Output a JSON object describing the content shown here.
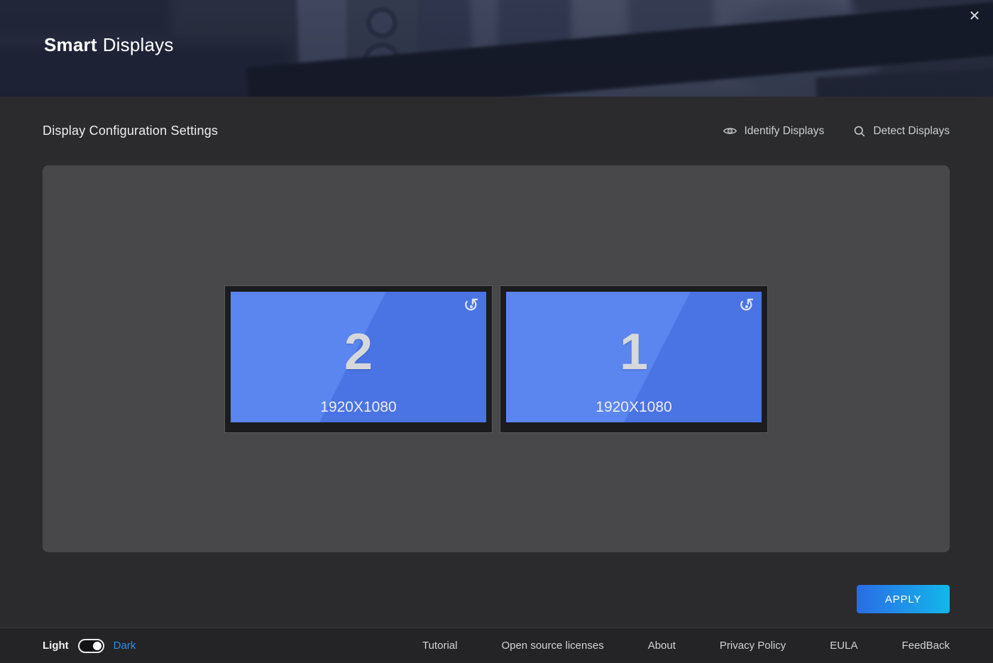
{
  "app": {
    "title_bold": "Smart",
    "title_regular": "Displays",
    "close_icon": "✕"
  },
  "main": {
    "heading": "Display Configuration Settings",
    "actions": {
      "identify_label": "Identify Displays",
      "detect_label": "Detect Displays"
    },
    "apply_label": "APPLY"
  },
  "displays": [
    {
      "number": "2",
      "resolution": "1920X1080",
      "rotate_icon": "↺"
    },
    {
      "number": "1",
      "resolution": "1920X1080",
      "rotate_icon": "↺"
    }
  ],
  "footer": {
    "theme": {
      "light_label": "Light",
      "dark_label": "Dark",
      "selected": "Dark"
    },
    "links": [
      "Tutorial",
      "Open source licenses",
      "About",
      "Privacy Policy",
      "EULA",
      "FeedBack"
    ]
  },
  "colors": {
    "accent_blue": "#2f8de9",
    "screen_blue_light": "#5b85ef",
    "screen_blue_dark": "#4a73e3",
    "apply_gradient_start": "#2b6ce6",
    "apply_gradient_end": "#12b7ea",
    "panel_bg": "#48484b",
    "page_bg": "#2b2b2d",
    "footer_bg": "#242427"
  }
}
